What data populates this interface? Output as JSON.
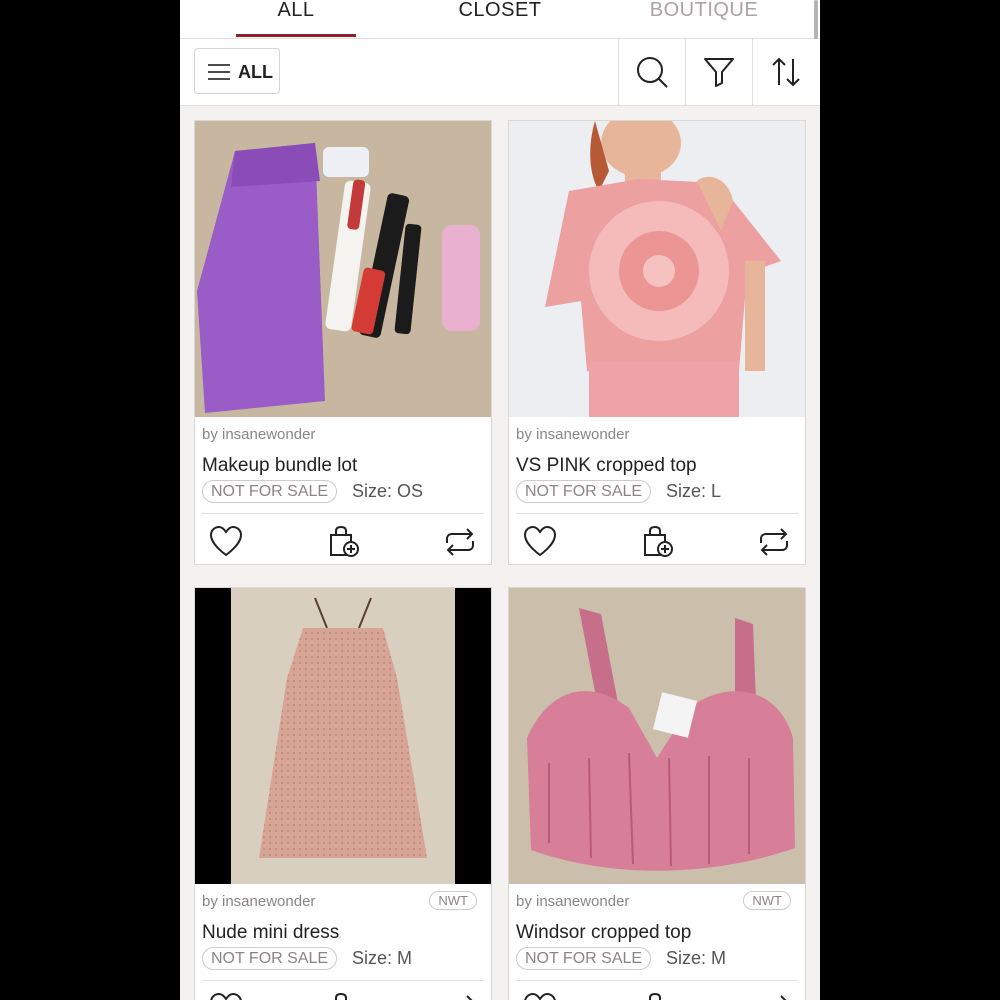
{
  "tabs": [
    {
      "label": "ALL"
    },
    {
      "label": "CLOSET"
    },
    {
      "label": "BOUTIQUE"
    }
  ],
  "toolbar": {
    "filter_label": "ALL",
    "icons": [
      "search-icon",
      "funnel-filter-icon",
      "sort-arrows-icon"
    ]
  },
  "colors": {
    "accent": "#8e1f2c",
    "background": "#f4f1f1",
    "muted_text": "#8a8585"
  },
  "listings": [
    {
      "seller": "by insanewonder",
      "title": "Makeup bundle lot",
      "status": "NOT FOR SALE",
      "size": "Size: OS",
      "badge": "",
      "photo": "purple makeup bag with lipsticks on satin sheet"
    },
    {
      "seller": "by insanewonder",
      "title": "VS PINK cropped top",
      "status": "NOT FOR SALE",
      "size": "Size: L",
      "badge": "",
      "photo": "pink tie-dye cropped tee on model"
    },
    {
      "seller": "by insanewonder",
      "title": "Nude mini dress",
      "status": "NOT FOR SALE",
      "size": "Size: M",
      "badge": "NWT",
      "photo": "nude pink slip mini dress on bed"
    },
    {
      "seller": "by insanewonder",
      "title": "Windsor cropped top",
      "status": "NOT FOR SALE",
      "size": "Size: M",
      "badge": "NWT",
      "photo": "pink satin corset cropped top"
    }
  ]
}
